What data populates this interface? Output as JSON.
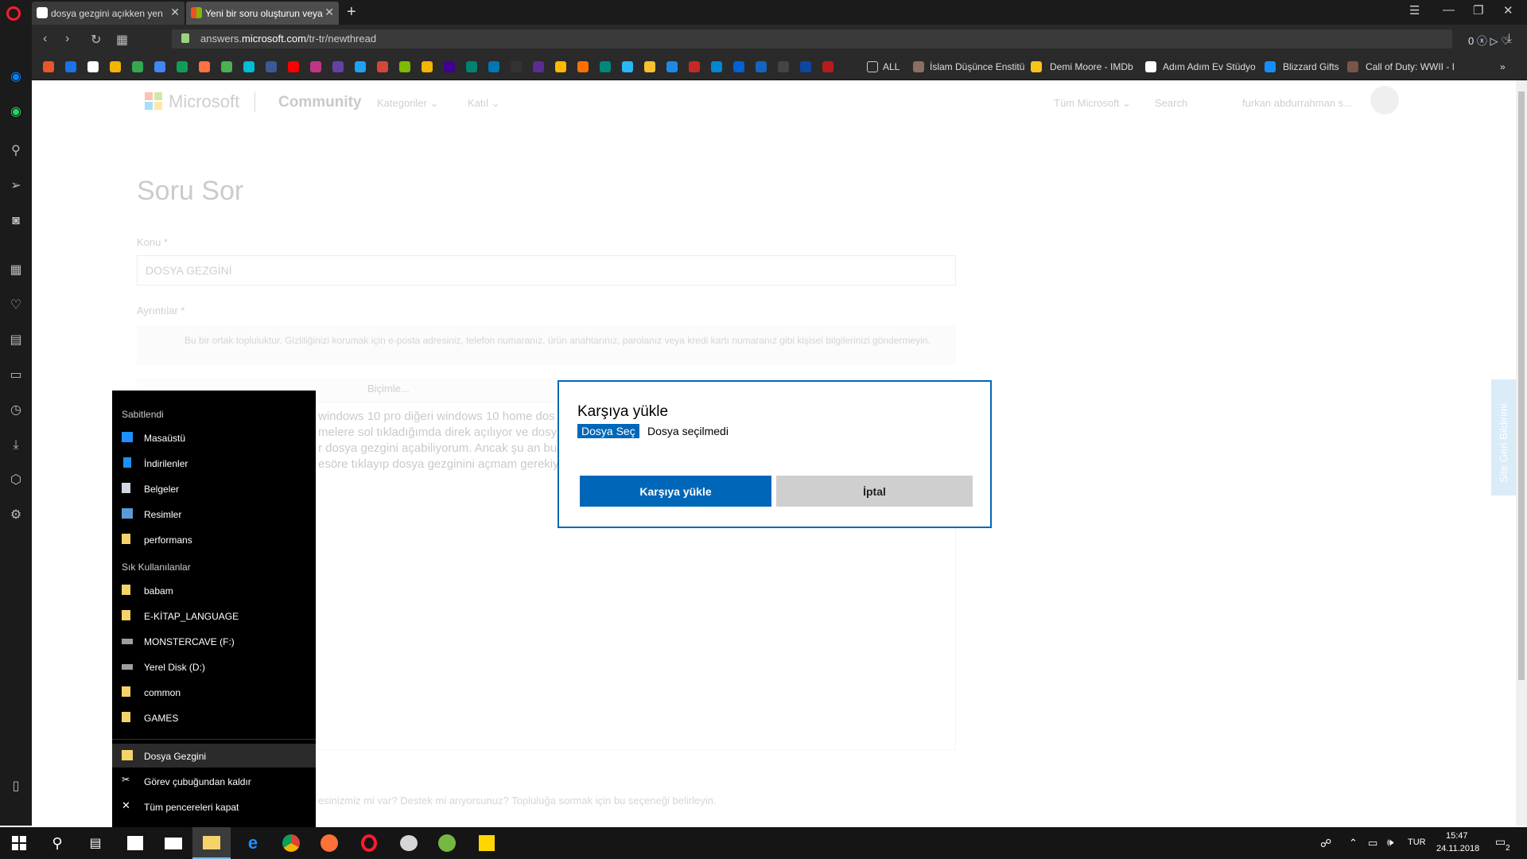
{
  "browser": {
    "tabs": [
      {
        "title": "dosya gezgini açıkken yen",
        "active": false
      },
      {
        "title": "Yeni bir soru oluşturun veya",
        "active": true
      }
    ],
    "url_prefix": "answers.",
    "url_host": "microsoft.com",
    "url_path": "/tr-tr/newthread",
    "address_right": "0 ⓧ ▷ ♡",
    "bookmarks": [
      {
        "label": "ALL"
      },
      {
        "label": "İslam Düşünce Enstitü"
      },
      {
        "label": "Demi Moore - IMDb"
      },
      {
        "label": "Adım Adım Ev Stüdyo"
      },
      {
        "label": "Blizzard Gifts"
      },
      {
        "label": "Call of Duty: WWII - I"
      }
    ]
  },
  "page": {
    "brand": "Microsoft",
    "community": "Community",
    "nav_categories": "Kategoriler ⌄",
    "nav_more": "Katıl ⌄",
    "all_microsoft": "Tüm Microsoft ⌄",
    "search": "Search",
    "user": "furkan abdurrahman s...",
    "title": "Soru Sor",
    "subject_label": "Konu *",
    "subject_value": "DOSYA GEZGİNİ",
    "details_label": "Ayrıntılar *",
    "notice": "Bu bir ortak topluluktur. Gizliliğinizi korumak için e-posta adresiniz, telefon numaranız, ürün anahtarınız, parolanız veya kredi kartı numaranız gibi kişisel bilgilerinizi göndermeyin.",
    "toolbar_format": "Biçimle...",
    "editor_line1": "windows 10 pro diğeri windows 10 home dos",
    "editor_line2": "melere sol tıkladığımda direk açılıyor ve dosy",
    "editor_line3": "r dosya gezgini açabiliyorum. Ancak şu an bu",
    "editor_line4": "esöre tıklayıp dosya gezginini açmam gerekiy",
    "footer_note": "esinizmiz mi var? Destek mi arıyorsunuz? Topluluğa sormak için bu seçeneği belirleyin.",
    "feedback": "Site Geri Bildirimi"
  },
  "dialog": {
    "title": "Karşıya yükle",
    "choose_file": "Dosya Seç",
    "no_file": "Dosya seçilmedi",
    "upload": "Karşıya yükle",
    "cancel": "İptal"
  },
  "jumplist": {
    "pinned_header": "Sabitlendi",
    "pinned": [
      "Masaüstü",
      "İndirilenler",
      "Belgeler",
      "Resimler",
      "performans"
    ],
    "frequent_header": "Sık Kullanılanlar",
    "frequent": [
      "babam",
      "E-KİTAP_LANGUAGE",
      "MONSTERCAVE (F:)",
      "Yerel Disk (D:)",
      "common",
      "GAMES"
    ],
    "actions": [
      "Dosya Gezgini",
      "Görev çubuğundan kaldır",
      "Tüm pencereleri kapat"
    ]
  },
  "taskbar": {
    "lang": "TUR",
    "time": "15:47",
    "date": "24.11.2018",
    "notifications": "2"
  },
  "colors": {
    "accent": "#0067b8",
    "chrome": "#1b1b1b",
    "taskbar": "#151515"
  }
}
